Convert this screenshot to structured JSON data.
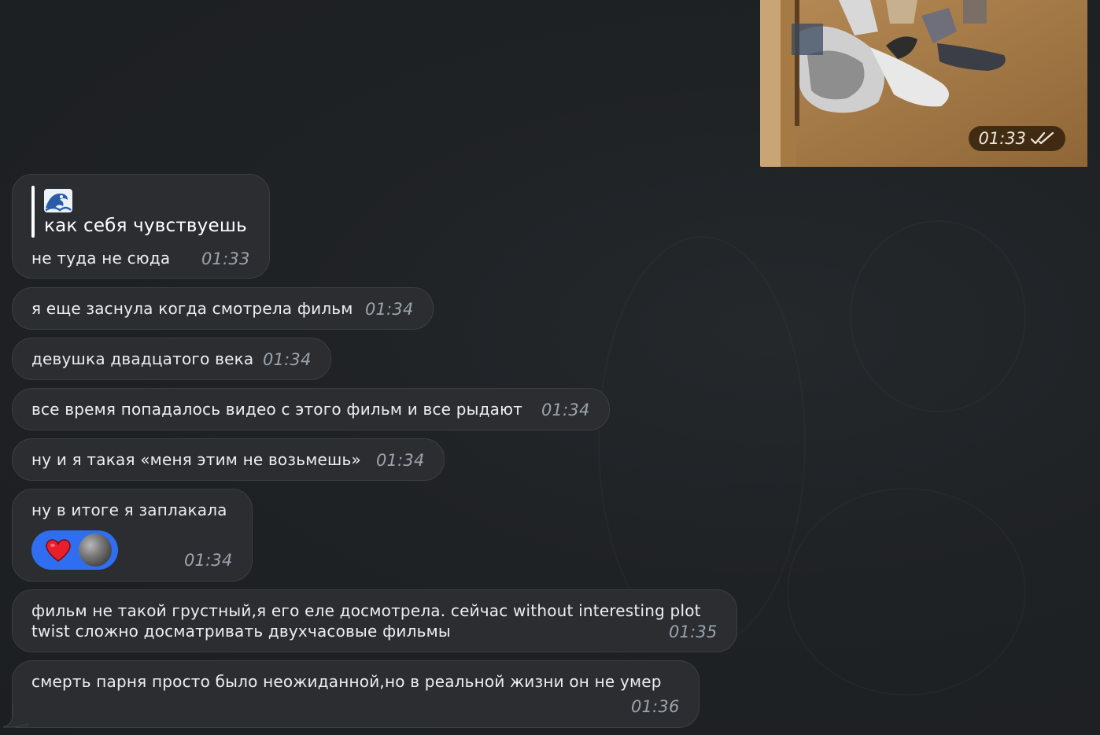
{
  "media_message": {
    "time": "01:33",
    "status_icon": "double-check-icon"
  },
  "messages": [
    {
      "reply": {
        "emoji": "🌊",
        "text": "как себя чувствуешь"
      },
      "text": "не туда не сюда",
      "time": "01:33"
    },
    {
      "text": "я еще заснула когда смотрела фильм",
      "time": "01:34"
    },
    {
      "text": "девушка двадцатого века",
      "time": "01:34"
    },
    {
      "text": "все время попадалось видео с этого фильм и все рыдают",
      "time": "01:34"
    },
    {
      "text": "ну и я такая «меня этим не возьмешь»",
      "time": "01:34"
    },
    {
      "text": "ну в итоге я заплакала",
      "time": "01:34",
      "reaction": {
        "emoji": "❤️",
        "icon": "heart-icon",
        "color": "#2f6ef0"
      }
    },
    {
      "text_lines": [
        "фильм не такой грустный,я его еле досмотрела. сейчас without interesting plot",
        "twist сложно досматривать двухчасовые фильмы"
      ],
      "time": "01:35"
    },
    {
      "text": "смерть парня просто было неожиданной,но в реальной жизни он не умер",
      "time": "01:36"
    }
  ],
  "colors": {
    "background": "#1e2124",
    "bubble": "#2b2d30",
    "bubble_border": "#3b3e42",
    "text": "#eceff2",
    "time": "#9ba3ad",
    "reaction": "#2f6ef0"
  }
}
